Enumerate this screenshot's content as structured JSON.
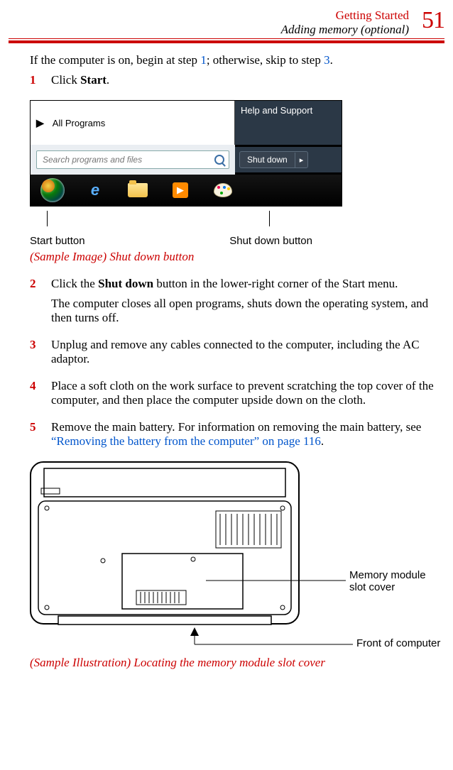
{
  "header": {
    "chapter": "Getting Started",
    "section": "Adding memory (optional)",
    "page_number": "51"
  },
  "intro": {
    "pre": "If the computer is on, begin at step ",
    "link1": "1",
    "mid": "; otherwise, skip to step ",
    "link2": "3",
    "post": "."
  },
  "steps": {
    "s1": {
      "num": "1",
      "pre": "Click ",
      "bold": "Start",
      "post": "."
    },
    "s2": {
      "num": "2",
      "p1_pre": "Click the ",
      "p1_bold": "Shut down",
      "p1_post": " button in the lower-right corner of the Start menu.",
      "p2": "The computer closes all open programs, shuts down the operating system, and then turns off."
    },
    "s3": {
      "num": "3",
      "text": "Unplug and remove any cables connected to the computer, including the AC adaptor."
    },
    "s4": {
      "num": "4",
      "text": "Place a soft cloth on the work surface to prevent scratching the top cover of the computer, and then place the computer upside down on the cloth."
    },
    "s5": {
      "num": "5",
      "pre": "Remove the main battery. For information on removing the main battery, see ",
      "link": "“Removing the battery from the computer” on page 116",
      "post": "."
    }
  },
  "screenshot1": {
    "help_label": "Help and Support",
    "all_programs": "All Programs",
    "search_placeholder": "Search programs and files",
    "shut_down": "Shut down"
  },
  "labels": {
    "start_button": "Start button",
    "shut_down_button": "Shut down button"
  },
  "caption1": "(Sample Image) Shut down button",
  "illustration2": {
    "mem_label": "Memory module slot cover",
    "front_label": "Front of computer"
  },
  "caption2": "(Sample Illustration) Locating the memory module slot cover"
}
